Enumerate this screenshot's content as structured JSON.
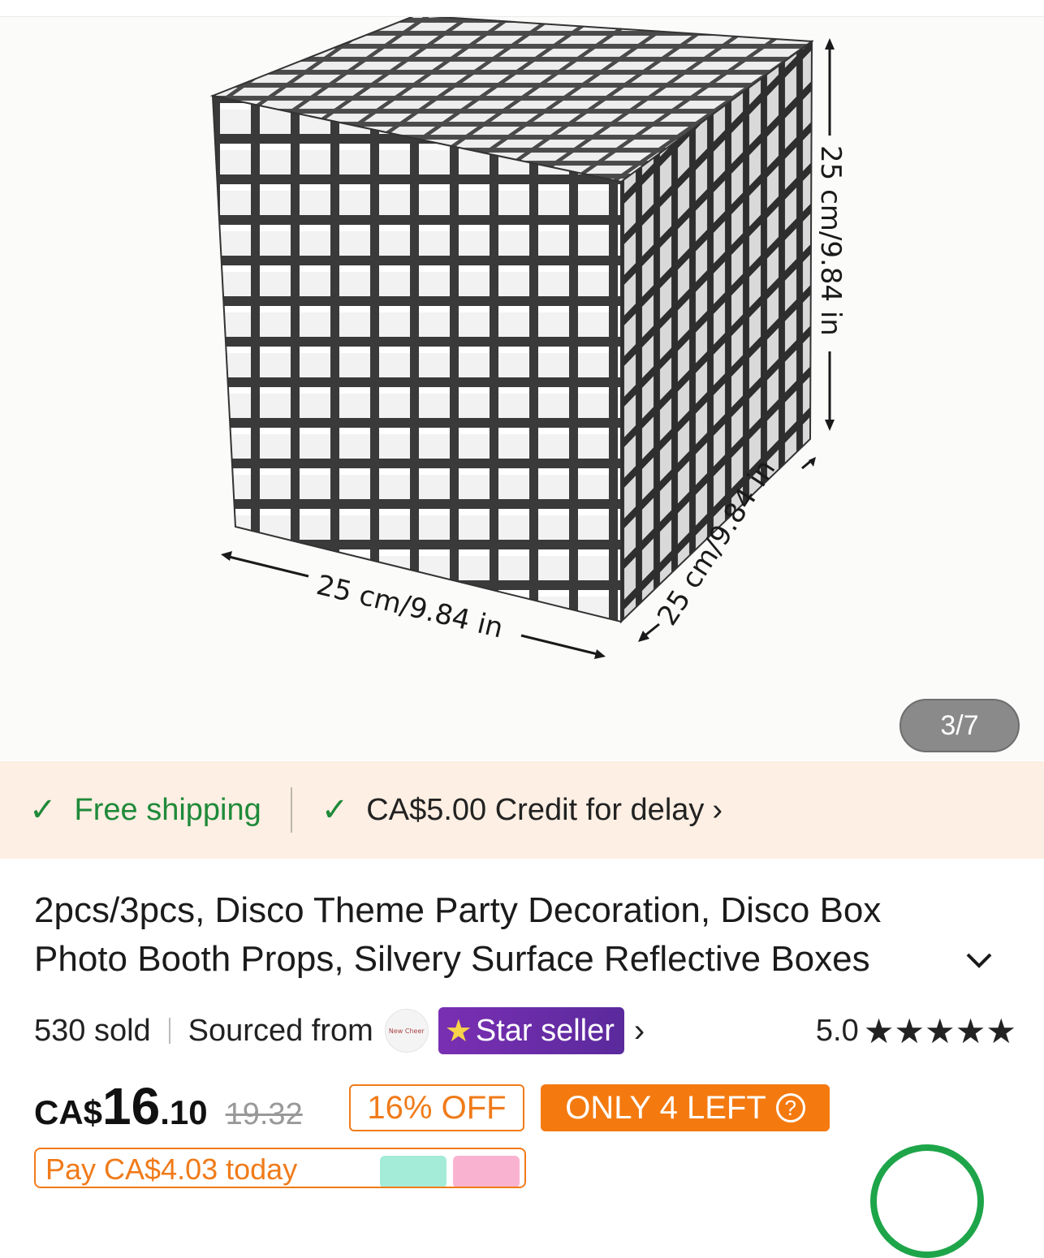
{
  "gallery": {
    "counter": "3/7",
    "dims": {
      "height": "25 cm/9.84 in",
      "width": "25 cm/9.84 in",
      "depth": "25 cm/9.84 in"
    }
  },
  "shipping": {
    "free": "Free shipping",
    "credit": "CA$5.00 Credit for delay",
    "credit_chevron": "›"
  },
  "product": {
    "title": "2pcs/3pcs, Disco Theme Party Decoration, Disco Box Photo Booth Props, Silvery Surface Reflective Boxes"
  },
  "meta": {
    "sold": "530 sold",
    "sourced": "Sourced from",
    "seller_logo": "New Cheer",
    "star_seller": "Star seller",
    "rating": "5.0",
    "stars": "★★★★★",
    "rating_value": 5
  },
  "price": {
    "currency": "CA$",
    "integer": "16",
    "decimal": ".10",
    "original": "19.32",
    "off": "16% OFF",
    "stock": "ONLY 4 LEFT",
    "stock_help": "?"
  },
  "pay": {
    "text": "Pay CA$4.03 today"
  },
  "colors": {
    "green": "#1f8a3a",
    "orange": "#f07b1a",
    "purple": "#6a2ca8",
    "ship_bg": "#fdefe3"
  }
}
